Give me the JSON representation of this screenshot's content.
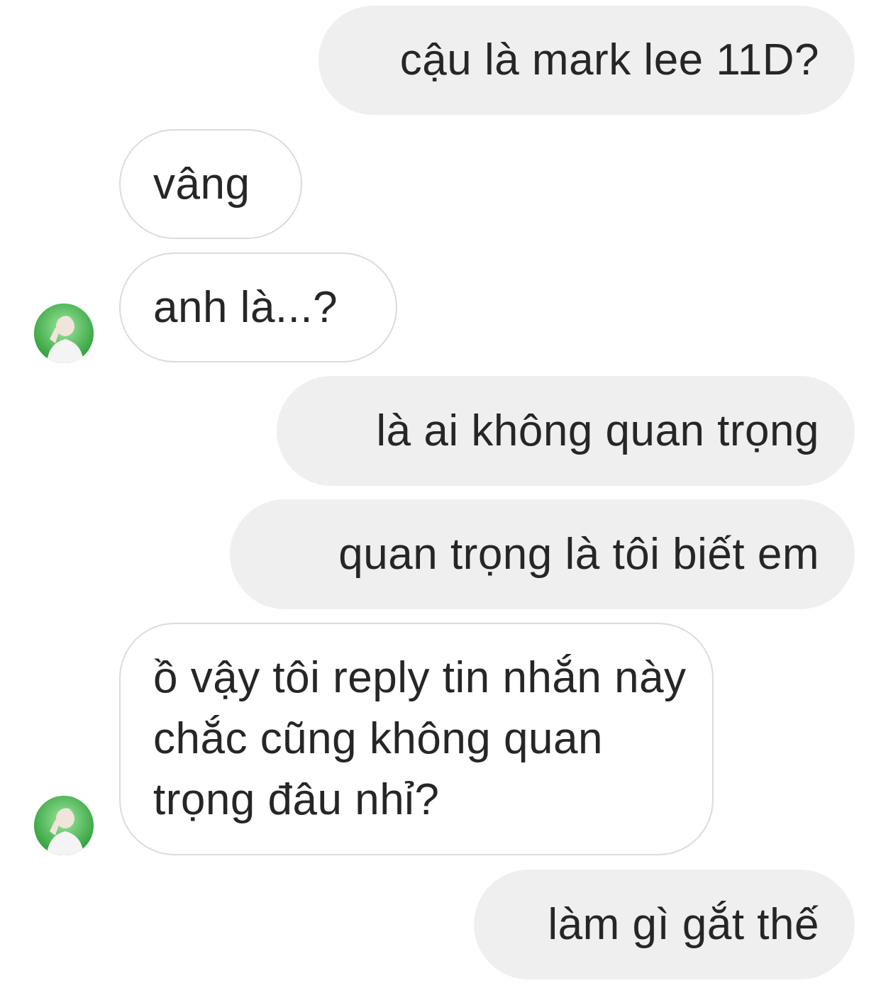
{
  "conversation": {
    "messages": [
      {
        "sender": "me",
        "text": "cậu là mark lee 11D?"
      },
      {
        "sender": "other",
        "text": "vâng"
      },
      {
        "sender": "other",
        "text": "anh là...?"
      },
      {
        "sender": "me",
        "text": "là ai không quan trọng"
      },
      {
        "sender": "me",
        "text": "quan trọng là tôi biết em"
      },
      {
        "sender": "other",
        "text": "ồ vậy tôi reply tin nhắn này chắc cũng không quan trọng đâu nhỉ?"
      },
      {
        "sender": "me",
        "text": "làm gì gắt thế"
      }
    ]
  },
  "colors": {
    "sent_bubble": "#efefef",
    "received_border": "#dbdbdb",
    "text": "#262626",
    "avatar_green": "#4cc24c"
  },
  "icons": {
    "avatar": "profile-photo"
  }
}
